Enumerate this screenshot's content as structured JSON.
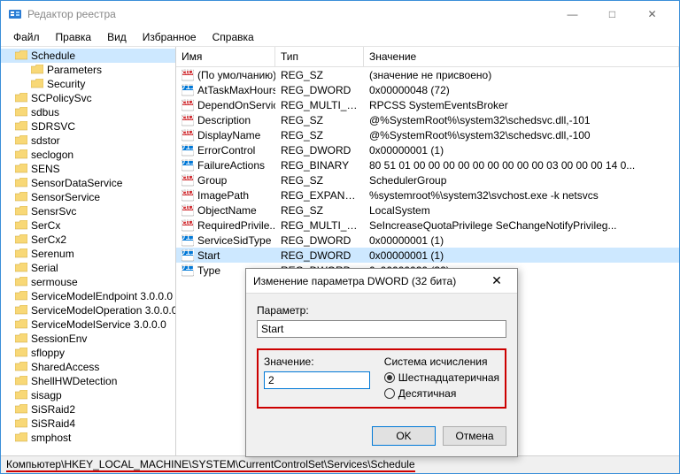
{
  "window": {
    "title": "Редактор реестра",
    "menu": [
      "Файл",
      "Правка",
      "Вид",
      "Избранное",
      "Справка"
    ]
  },
  "tree": {
    "selected": "Schedule",
    "items": [
      {
        "label": "Schedule",
        "selected": true,
        "indent": 0
      },
      {
        "label": "Parameters",
        "indent": 1
      },
      {
        "label": "Security",
        "indent": 1
      },
      {
        "label": "SCPolicySvc",
        "indent": 0
      },
      {
        "label": "sdbus",
        "indent": 0
      },
      {
        "label": "SDRSVC",
        "indent": 0
      },
      {
        "label": "sdstor",
        "indent": 0
      },
      {
        "label": "seclogon",
        "indent": 0
      },
      {
        "label": "SENS",
        "indent": 0
      },
      {
        "label": "SensorDataService",
        "indent": 0
      },
      {
        "label": "SensorService",
        "indent": 0
      },
      {
        "label": "SensrSvc",
        "indent": 0
      },
      {
        "label": "SerCx",
        "indent": 0
      },
      {
        "label": "SerCx2",
        "indent": 0
      },
      {
        "label": "Serenum",
        "indent": 0
      },
      {
        "label": "Serial",
        "indent": 0
      },
      {
        "label": "sermouse",
        "indent": 0
      },
      {
        "label": "ServiceModelEndpoint 3.0.0.0",
        "indent": 0
      },
      {
        "label": "ServiceModelOperation 3.0.0.0",
        "indent": 0
      },
      {
        "label": "ServiceModelService 3.0.0.0",
        "indent": 0
      },
      {
        "label": "SessionEnv",
        "indent": 0
      },
      {
        "label": "sfloppy",
        "indent": 0
      },
      {
        "label": "SharedAccess",
        "indent": 0
      },
      {
        "label": "ShellHWDetection",
        "indent": 0
      },
      {
        "label": "sisagp",
        "indent": 0
      },
      {
        "label": "SiSRaid2",
        "indent": 0
      },
      {
        "label": "SiSRaid4",
        "indent": 0
      },
      {
        "label": "smphost",
        "indent": 0
      }
    ]
  },
  "list": {
    "headers": {
      "name": "Имя",
      "type": "Тип",
      "value": "Значение"
    },
    "rows": [
      {
        "icon": "sz",
        "name": "(По умолчанию)",
        "type": "REG_SZ",
        "value": "(значение не присвоено)"
      },
      {
        "icon": "dw",
        "name": "AtTaskMaxHours",
        "type": "REG_DWORD",
        "value": "0x00000048 (72)"
      },
      {
        "icon": "sz",
        "name": "DependOnService",
        "type": "REG_MULTI_SZ",
        "value": "RPCSS SystemEventsBroker"
      },
      {
        "icon": "sz",
        "name": "Description",
        "type": "REG_SZ",
        "value": "@%SystemRoot%\\system32\\schedsvc.dll,-101"
      },
      {
        "icon": "sz",
        "name": "DisplayName",
        "type": "REG_SZ",
        "value": "@%SystemRoot%\\system32\\schedsvc.dll,-100"
      },
      {
        "icon": "dw",
        "name": "ErrorControl",
        "type": "REG_DWORD",
        "value": "0x00000001 (1)"
      },
      {
        "icon": "bin",
        "name": "FailureActions",
        "type": "REG_BINARY",
        "value": "80 51 01 00 00 00 00 00 00 00 00 00 03 00 00 00 14 0..."
      },
      {
        "icon": "sz",
        "name": "Group",
        "type": "REG_SZ",
        "value": "SchedulerGroup"
      },
      {
        "icon": "sz",
        "name": "ImagePath",
        "type": "REG_EXPAND_SZ",
        "value": "%systemroot%\\system32\\svchost.exe -k netsvcs"
      },
      {
        "icon": "sz",
        "name": "ObjectName",
        "type": "REG_SZ",
        "value": "LocalSystem"
      },
      {
        "icon": "sz",
        "name": "RequiredPrivile...",
        "type": "REG_MULTI_SZ",
        "value": "SeIncreaseQuotaPrivilege SeChangeNotifyPrivileg..."
      },
      {
        "icon": "dw",
        "name": "ServiceSidType",
        "type": "REG_DWORD",
        "value": "0x00000001 (1)"
      },
      {
        "icon": "dw",
        "name": "Start",
        "type": "REG_DWORD",
        "value": "0x00000001 (1)",
        "selected": true,
        "underline": true
      },
      {
        "icon": "dw",
        "name": "Type",
        "type": "REG_DWORD",
        "value": "0x00000020 (32)"
      }
    ]
  },
  "dialog": {
    "title": "Изменение параметра DWORD (32 бита)",
    "param_label": "Параметр:",
    "param_value": "Start",
    "value_label": "Значение:",
    "value_value": "2",
    "radix_label": "Система исчисления",
    "radix_hex": "Шестнадцатеричная",
    "radix_dec": "Десятичная",
    "ok": "OK",
    "cancel": "Отмена"
  },
  "statusbar": {
    "path": "Компьютер\\HKEY_LOCAL_MACHINE\\SYSTEM\\CurrentControlSet\\Services\\Schedule"
  }
}
